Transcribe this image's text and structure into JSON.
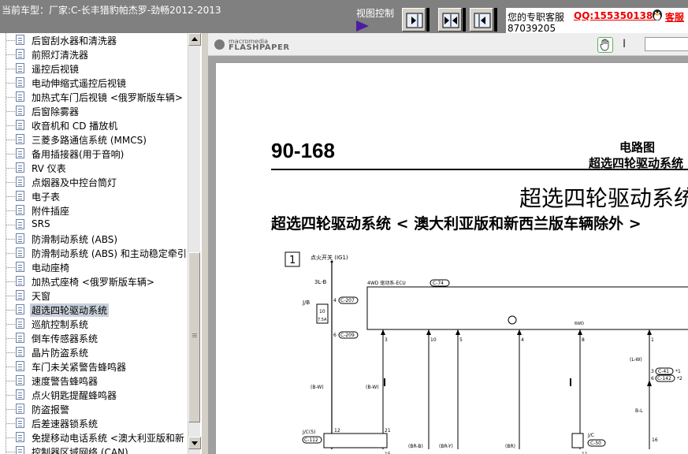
{
  "header": {
    "title": "当前车型：厂家:C-长丰猎豹帕杰罗-劲畅2012-2013",
    "view_control_label": "视图控制"
  },
  "support": {
    "label": "您的专职客服",
    "qq": "QQ:1553501388",
    "qq_tail": "客服",
    "phone": "87039205"
  },
  "sidebar": {
    "selected_index": 19,
    "items": [
      {
        "label": "后窗刮水器和清洗器"
      },
      {
        "label": "前照灯清洗器"
      },
      {
        "label": "遥控后视镜"
      },
      {
        "label": "电动伸缩式遥控后视镜"
      },
      {
        "label": "加热式车门后视镜 <俄罗斯版车辆>"
      },
      {
        "label": "后窗除雾器"
      },
      {
        "label": "收音机和 CD 播放机"
      },
      {
        "label": "三菱多路通信系统 (MMCS)"
      },
      {
        "label": "备用插接器(用于音响)"
      },
      {
        "label": "RV 仪表"
      },
      {
        "label": "点烟器及中控台筒灯"
      },
      {
        "label": "电子表"
      },
      {
        "label": "附件插座"
      },
      {
        "label": "SRS"
      },
      {
        "label": "防滑制动系统 (ABS)"
      },
      {
        "label": "防滑制动系统 (ABS) 和主动稳定牵引"
      },
      {
        "label": "电动座椅"
      },
      {
        "label": "加热式座椅 <俄罗斯版车辆>"
      },
      {
        "label": "天窗"
      },
      {
        "label": "超选四轮驱动系统"
      },
      {
        "label": "巡航控制系统"
      },
      {
        "label": "倒车传感器系统"
      },
      {
        "label": "晶片防盗系统"
      },
      {
        "label": "车门未关紧警告蜂鸣器"
      },
      {
        "label": "速度警告蜂鸣器"
      },
      {
        "label": "点火钥匙提醒蜂鸣器"
      },
      {
        "label": "防盗报警"
      },
      {
        "label": "后差速器锁系统"
      },
      {
        "label": "免提移动电话系统 <澳大利亚版和新"
      },
      {
        "label": "控制器区域网络 (CAN)"
      }
    ]
  },
  "viewer": {
    "brand_top": "macromedia",
    "brand_name": "FLASHPAPER",
    "text_tool_icon": "text-cursor-icon",
    "hand_tool_icon": "hand-icon"
  },
  "page": {
    "number": "90-168",
    "section": "电路图",
    "subsection": "超选四轮驱动系统",
    "big_title": "超选四轮驱动系统",
    "subtitle": "超选四轮驱动系统 < 澳大利亚版和新西兰版车辆除外 >"
  },
  "diagram": {
    "box_num": "1",
    "top_label": "点火开关 (IG1)",
    "wire_3l_b": "3L-B",
    "jb_label": "J/B",
    "fuse_label": "10",
    "fuse_amp": "7.5A",
    "c207": "C-207",
    "c209": "C-209",
    "pin4": "4",
    "pin6": "6",
    "ecu_label": "4WD 驱动系-ECU",
    "c74": "C-74",
    "bw1": "(B-W)",
    "bw2": "(B-W)",
    "jc5": "J/C(5)",
    "c112": "C-112",
    "pins_top": [
      "3",
      "10",
      "5",
      "4",
      "8",
      "1"
    ],
    "pin_6wd": "6WD",
    "pin12": "12",
    "pin21": "21",
    "pin15": "15",
    "br_b": "(BR-B)",
    "br_y": "(BR-Y)",
    "br": "(BR)",
    "jc_right": "J/C",
    "c50": "C-50",
    "pin11": "11",
    "lw": "(L-W)",
    "c41": "C-41",
    "c142": "C-142",
    "bl": "B-L",
    "pin16": "16",
    "pin3": "3",
    "pin6b": "6",
    "star1": "*1",
    "star2": "*2"
  },
  "colors": {
    "topbar_bg": "#808080",
    "accent_purple": "#4a1e9e",
    "qq_red": "#e00000",
    "selected_bg": "#c8d0dc"
  }
}
